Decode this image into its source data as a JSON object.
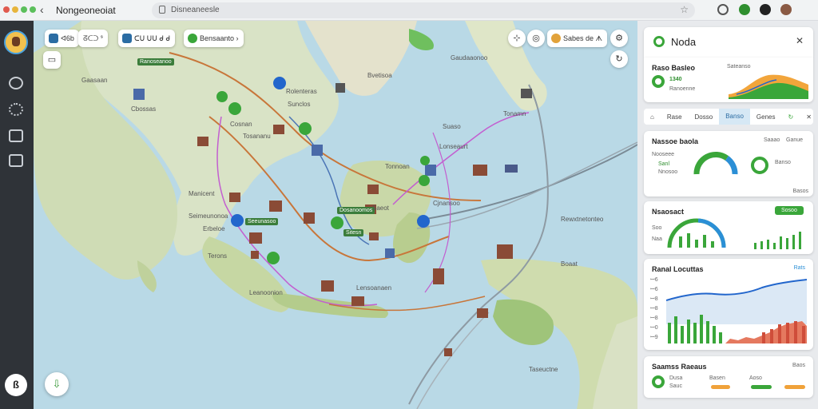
{
  "browser": {
    "tab_title": "Nongeoneoiat",
    "url": "Disneaneesle",
    "back_glyph": "‹",
    "star_glyph": "☆",
    "dot_colors": [
      "#e05a4e",
      "#e7b53c",
      "#5bbf5b"
    ]
  },
  "rail": {
    "bottom_button": "ß",
    "items": [
      "refresh-icon",
      "settings-icon",
      "window-icon",
      "book-icon"
    ]
  },
  "map": {
    "chips": [
      {
        "label": "ᐊ6b",
        "icon": "phone-icon",
        "color": "#2b6ca3"
      },
      {
        "label": "ᘔᑕᑐ ᔆ",
        "icon": "",
        "color": "#555"
      },
      {
        "label": "ᑕᑌ ᑌᑌ ᑯ ᑯ",
        "icon": "shield-icon",
        "color": "#2b6ca3"
      },
      {
        "label": "Bensaanto ›",
        "icon": "leaf-icon",
        "color": "#3aa63a"
      }
    ],
    "right_chip": "Sabes de ᗑ",
    "labels": [
      "Gaasaan",
      "Cbossas",
      "Cosnan",
      "Tosananu",
      "Gaudaaonoo",
      "Bvetisoa",
      "Rolenteras",
      "Sunclos",
      "Suaso",
      "Tonamn",
      "Lonseaurt",
      "Tonnoan",
      "Manicent",
      "Erbeloe",
      "Terons",
      "Saeot",
      "Cjnansoo",
      "Rewxtnetonteo",
      "Leanoonion",
      "Lensoanaen",
      "Boaat",
      "Taseuctne",
      "Seimeunonoa"
    ],
    "tags": [
      "Ranoseanoo",
      "Seeunasoo",
      "Dosanoomos",
      "Sitesn"
    ],
    "compass_glyph": "⇩"
  },
  "panel": {
    "header": {
      "title": "Noda",
      "close": "✕"
    },
    "card1": {
      "title": "Raso Basleo",
      "value": "1340",
      "sub": "Ranoenne",
      "right": "Sateanso"
    },
    "tabs": [
      "Rase",
      "Dosso",
      "Banso",
      "Genes"
    ],
    "tab_icons": [
      "↻",
      "✕"
    ],
    "card2": {
      "title": "Nassoe baola",
      "left_a": "Nooseee",
      "left_b": "Sanl",
      "left_c": "Nnosoo",
      "right_a": "Saaao",
      "right_b": "Ganue",
      "right_c": "Banso",
      "footer": "Basos"
    },
    "card3": {
      "title": "Nsaosact",
      "badge": "Sosoo",
      "left": "Soo",
      "left2": "Naa"
    },
    "card4": {
      "title": "Ranal Locuttas",
      "right": "Rats",
      "ticks": [
        "ꟷ6",
        "ꟷ6",
        "ꟷ8",
        "ꟷ8",
        "ꟷ8",
        "ꟷ0",
        "ꟷ9"
      ]
    },
    "card5": {
      "title": "Saamss Raeaus",
      "right": "Baos",
      "items": [
        "Dusa",
        "Sauc",
        "Basen",
        "Aoso"
      ]
    }
  }
}
